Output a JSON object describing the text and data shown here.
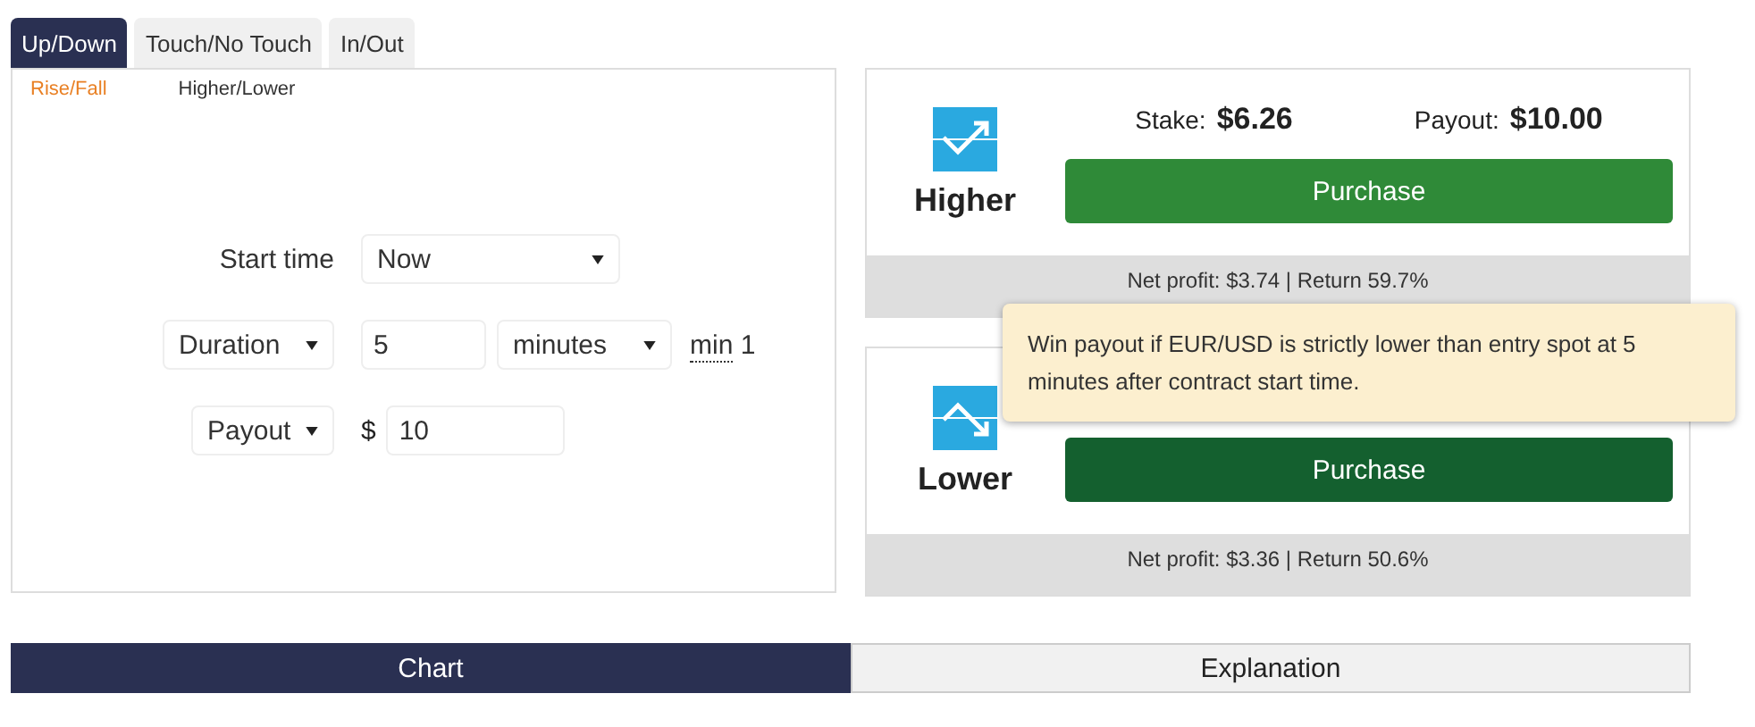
{
  "tabs": [
    {
      "label": "Up/Down",
      "selected": true
    },
    {
      "label": "Touch/No Touch",
      "selected": false
    },
    {
      "label": "In/Out",
      "selected": false
    }
  ],
  "subtabs": [
    {
      "label": "Rise/Fall",
      "selected": true
    },
    {
      "label": "Higher/Lower",
      "selected": false
    }
  ],
  "form": {
    "start_time": {
      "label": "Start time",
      "value": "Now"
    },
    "duration": {
      "mode": "Duration",
      "amount": "5",
      "unit": "minutes",
      "min_prefix": "min",
      "min_value": "1"
    },
    "amount": {
      "basis": "Payout",
      "currency": "$",
      "value": "10"
    }
  },
  "contracts": [
    {
      "kind": "higher",
      "title": "Higher",
      "stake_label": "Stake:",
      "stake": "$6.26",
      "payout_label": "Payout:",
      "payout": "$10.00",
      "button": "Purchase",
      "hovered": false,
      "footer": "Net profit: $3.74 | Return 59.7%"
    },
    {
      "kind": "lower",
      "title": "Lower",
      "button": "Purchase",
      "hovered": true,
      "footer": "Net profit: $3.36 | Return 50.6%"
    }
  ],
  "tooltip": "Win payout if EUR/USD is strictly lower than entry spot at 5 minutes after contract start time.",
  "bottom_tabs": [
    {
      "label": "Chart",
      "selected": true
    },
    {
      "label": "Explanation",
      "selected": false
    }
  ]
}
